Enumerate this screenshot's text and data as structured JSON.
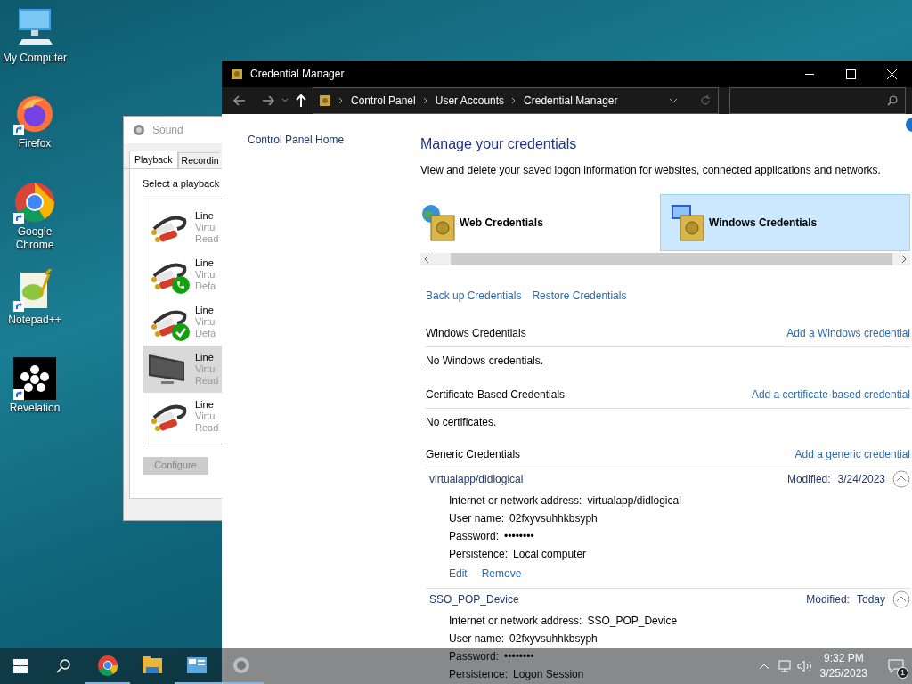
{
  "desktop_icons": [
    {
      "label": "My Computer",
      "kind": "computer",
      "shortcut": false
    },
    {
      "label": "Firefox",
      "kind": "firefox",
      "shortcut": true
    },
    {
      "label": "Google Chrome",
      "kind": "chrome",
      "shortcut": true
    },
    {
      "label": "Notepad++",
      "kind": "notepad",
      "shortcut": true
    },
    {
      "label": "Revelation",
      "kind": "revelation",
      "shortcut": true
    }
  ],
  "sound_window": {
    "title": "Sound",
    "tabs": [
      {
        "label": "Playback",
        "selected": true
      },
      {
        "label": "Recordin",
        "selected": false
      }
    ],
    "instruction": "Select a playback",
    "devices": [
      {
        "kind": "cable",
        "selected": false,
        "lines": [
          "Line",
          "Virtu",
          "Read"
        ]
      },
      {
        "kind": "cable_phone",
        "selected": false,
        "lines": [
          "Line",
          "Virtu",
          "Defa"
        ]
      },
      {
        "kind": "cable_check",
        "selected": false,
        "lines": [
          "Line",
          "Virtu",
          "Defa"
        ]
      },
      {
        "kind": "monitor",
        "selected": true,
        "lines": [
          "Line",
          "Virtu",
          "Read"
        ]
      },
      {
        "kind": "cable",
        "selected": false,
        "lines": [
          "Line",
          "Virtu",
          "Read"
        ]
      }
    ],
    "configure_button": {
      "label": "Configure",
      "disabled": true
    }
  },
  "credential_window": {
    "title": "Credential Manager",
    "breadcrumb": [
      "Control Panel",
      "User Accounts",
      "Credential Manager"
    ],
    "sidebar_link": "Control Panel Home",
    "heading": "Manage your credentials",
    "description": "View and delete your saved logon information for websites, connected applications and networks.",
    "categories": [
      {
        "label": "Web Credentials",
        "kind": "web",
        "selected": false
      },
      {
        "label": "Windows Credentials",
        "kind": "windows",
        "selected": true
      }
    ],
    "actions": [
      "Back up Credentials",
      "Restore Credentials"
    ],
    "sections": [
      {
        "title": "Windows Credentials",
        "add_link": "Add a Windows credential",
        "empty_text": "No Windows credentials."
      },
      {
        "title": "Certificate-Based Credentials",
        "add_link": "Add a certificate-based credential",
        "empty_text": "No certificates."
      },
      {
        "title": "Generic Credentials",
        "add_link": "Add a generic credential",
        "entries": [
          {
            "name": "virtualapp/didlogical",
            "modified_label": "Modified:",
            "modified": "3/24/2023",
            "expanded": true,
            "fields": [
              {
                "label": "Internet or network address:",
                "value": "virtualapp/didlogical"
              },
              {
                "label": "User name:",
                "value": "02fxyvsuhhkbsyph"
              },
              {
                "label": "Password:",
                "value": "••••••••"
              },
              {
                "label": "Persistence:",
                "value": "Local computer"
              }
            ],
            "links": [
              "Edit",
              "Remove"
            ]
          },
          {
            "name": "SSO_POP_Device",
            "modified_label": "Modified:",
            "modified": "Today",
            "expanded": true,
            "fields": [
              {
                "label": "Internet or network address:",
                "value": "SSO_POP_Device"
              },
              {
                "label": "User name:",
                "value": "02fxyvsuhhkbsyph"
              },
              {
                "label": "Password:",
                "value": "••••••••"
              },
              {
                "label": "Persistence:",
                "value": "Logon Session"
              }
            ]
          }
        ]
      }
    ]
  },
  "taskbar": {
    "apps": [
      {
        "kind": "chrome",
        "running": true
      },
      {
        "kind": "explorer",
        "running": false
      },
      {
        "kind": "control-panel",
        "running": true
      },
      {
        "kind": "sound",
        "running": true
      }
    ],
    "time": "9:32 PM",
    "date": "3/25/2023",
    "notification_count": "1"
  }
}
